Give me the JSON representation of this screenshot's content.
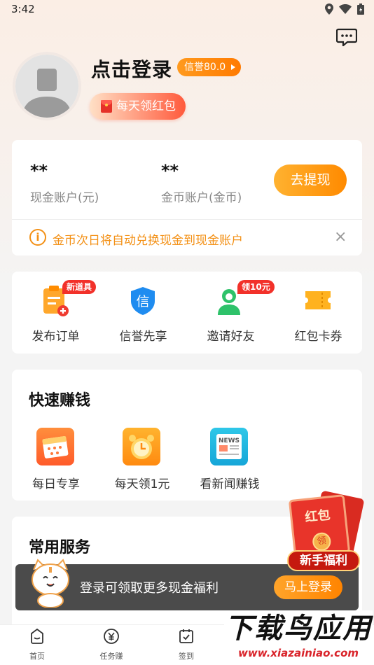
{
  "status": {
    "time": "3:42"
  },
  "profile": {
    "login_label": "点击登录",
    "credit_label": "信誉80.0",
    "daily_redpack_label": "每天领红包"
  },
  "accounts": {
    "cash_value": "**",
    "cash_label": "现金账户(元)",
    "gold_value": "**",
    "gold_label": "金币账户(金币)",
    "withdraw_label": "去提现",
    "notice": "金币次日将自动兑换现金到现金账户"
  },
  "grid": {
    "items": [
      {
        "label": "发布订单",
        "tag": "新道具",
        "icon": "publish-order-icon"
      },
      {
        "label": "信誉先享",
        "icon": "credit-shield-icon",
        "icon_text": "信"
      },
      {
        "label": "邀请好友",
        "tag": "领10元",
        "icon": "invite-friend-icon"
      },
      {
        "label": "红包卡券",
        "icon": "coupon-ticket-icon"
      }
    ]
  },
  "quick": {
    "title": "快速赚钱",
    "items": [
      {
        "label": "每日专享",
        "icon": "calendar-icon"
      },
      {
        "label": "每天领1元",
        "icon": "alarm-clock-icon"
      },
      {
        "label": "看新闻赚钱",
        "icon": "news-icon",
        "icon_text": "NEWS"
      }
    ]
  },
  "services": {
    "title": "常用服务"
  },
  "toast": {
    "text": "登录可领取更多现金福利",
    "button": "马上登录"
  },
  "float_redpack": {
    "title": "红包",
    "coin": "领",
    "ribbon": "新手福利"
  },
  "nav": {
    "items": [
      {
        "label": "首页",
        "icon": "home-icon"
      },
      {
        "label": "任务赚",
        "icon": "yuan-icon"
      },
      {
        "label": "签到",
        "icon": "checkin-icon"
      }
    ]
  },
  "watermark": {
    "title": "下载鸟应用",
    "url": "www.xiazainiao.com"
  },
  "colors": {
    "accent": "#ff8a00",
    "notice": "#f39015",
    "tag_red": "#f2312a"
  }
}
